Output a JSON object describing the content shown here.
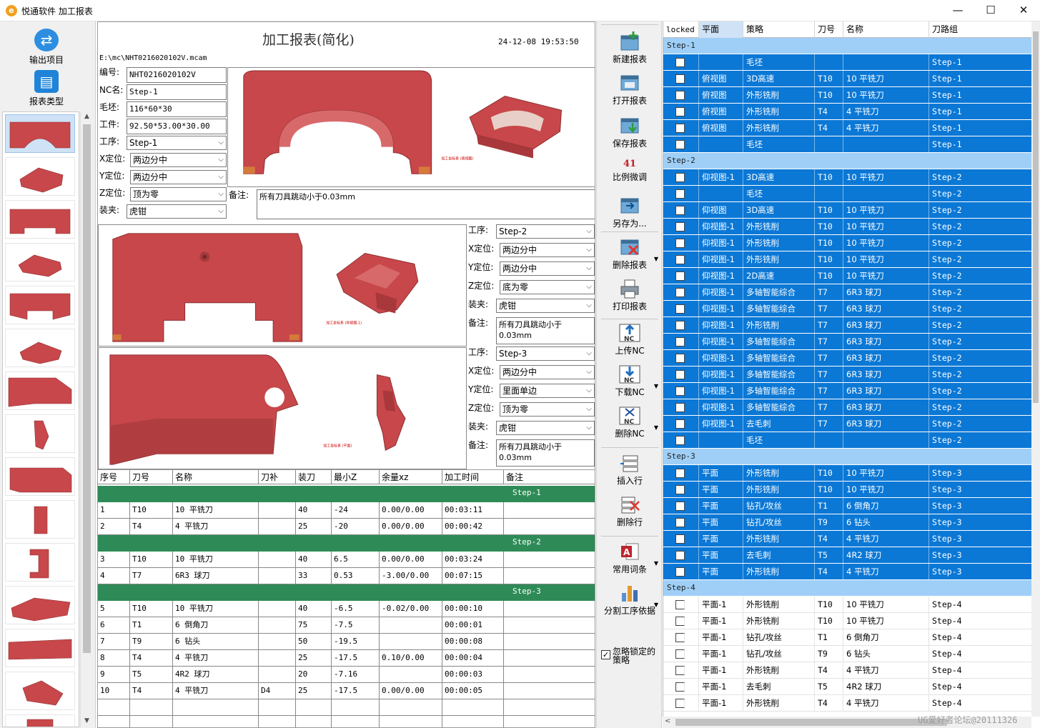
{
  "window": {
    "title": "悦通软件  加工报表",
    "minimize_label": "—",
    "maximize_label": "☐",
    "close_label": "✕"
  },
  "leftnav": {
    "export_label": "输出项目",
    "type_label": "报表类型"
  },
  "report": {
    "title": "加工报表(简化)",
    "datetime": "24-12-08 19:53:50",
    "path": "E:\\mc\\NHT0216020102V.mcam",
    "fields": {
      "number_label": "编号:",
      "number_value": "NHT0216020102V",
      "nc_label": "NC名:",
      "nc_value": "Step-1",
      "blank_label": "毛坯:",
      "blank_value": "116*60*30",
      "part_label": "工件:",
      "part_value": "92.50*53.00*30.00",
      "process_label": "工序:",
      "process_value": "Step-1",
      "x_label": "X定位:",
      "x_value": "两边分中",
      "y_label": "Y定位:",
      "y_value": "两边分中",
      "z_label": "Z定位:",
      "z_value": "顶为零",
      "clamp_label": "装夹:",
      "clamp_value": "虎钳",
      "note_label": "备注:",
      "note_value": "所有刀具跳动小于0.03mm"
    },
    "step2": {
      "process_label": "工序:",
      "process_value": "Step-2",
      "x_label": "X定位:",
      "x_value": "两边分中",
      "y_label": "Y定位:",
      "y_value": "两边分中",
      "z_label": "Z定位:",
      "z_value": "底为零",
      "clamp_label": "装夹:",
      "clamp_value": "虎钳",
      "note_label": "备注:",
      "note_value": "所有刀具跳动小于0.03mm"
    },
    "step3": {
      "process_label": "工序:",
      "process_value": "Step-3",
      "x_label": "X定位:",
      "x_value": "两边分中",
      "y_label": "Y定位:",
      "y_value": "里面单边",
      "z_label": "Z定位:",
      "z_value": "顶为零",
      "clamp_label": "装夹:",
      "clamp_value": "虎钳",
      "note_label": "备注:",
      "note_value": "所有刀具跳动小于0.03mm"
    },
    "ops_headers": [
      "序号",
      "刀号",
      "名称",
      "刀补",
      "装刀",
      "最小Z",
      "余量xz",
      "加工时间",
      "备注"
    ],
    "ops_groups": [
      {
        "label": "Step-1",
        "rows": [
          [
            "1",
            "T10",
            "10 平铣刀",
            "",
            "40",
            "-24",
            "0.00/0.00",
            "00:03:11",
            ""
          ],
          [
            "2",
            "T4",
            "4 平铣刀",
            "",
            "25",
            "-20",
            "0.00/0.00",
            "00:00:42",
            ""
          ]
        ]
      },
      {
        "label": "Step-2",
        "rows": [
          [
            "3",
            "T10",
            "10 平铣刀",
            "",
            "40",
            "6.5",
            "0.00/0.00",
            "00:03:24",
            ""
          ],
          [
            "4",
            "T7",
            "6R3 球刀",
            "",
            "33",
            "0.53",
            "-3.00/0.00",
            "00:07:15",
            ""
          ]
        ]
      },
      {
        "label": "Step-3",
        "rows": [
          [
            "5",
            "T10",
            "10 平铣刀",
            "",
            "40",
            "-6.5",
            "-0.02/0.00",
            "00:00:10",
            ""
          ],
          [
            "6",
            "T1",
            "6 倒角刀",
            "",
            "75",
            "-7.5",
            "",
            "00:00:01",
            ""
          ],
          [
            "7",
            "T9",
            "6 钻头",
            "",
            "50",
            "-19.5",
            "",
            "00:00:08",
            ""
          ],
          [
            "8",
            "T4",
            "4 平铣刀",
            "",
            "25",
            "-17.5",
            "0.10/0.00",
            "00:00:04",
            ""
          ],
          [
            "9",
            "T5",
            "4R2 球刀",
            "",
            "20",
            "-7.16",
            "",
            "00:00:03",
            ""
          ],
          [
            "10",
            "T4",
            "4 平铣刀",
            "D4",
            "25",
            "-17.5",
            "0.00/0.00",
            "00:00:05",
            ""
          ]
        ]
      }
    ]
  },
  "toolbar": {
    "new_report": "新建报表",
    "open_report": "打开报表",
    "save_report": "保存报表",
    "scale_value": "41",
    "scale_adjust": "比例微调",
    "save_as": "另存为...",
    "delete_report": "删除报表",
    "print_report": "打印报表",
    "upload_nc": "上传NC",
    "download_nc": "下载NC",
    "delete_nc": "删除NC",
    "insert_row": "插入行",
    "delete_row": "删除行",
    "common_terms": "常用词条",
    "split_process": "分割工序依据",
    "ignore_locked": "忽略锁定的策略",
    "nc_badge": "NC"
  },
  "grid": {
    "headers": [
      "locked",
      "平面",
      "策略",
      "刀号",
      "名称",
      "刀路组"
    ],
    "groups": [
      {
        "label": "Step-1",
        "selected": true,
        "rows": [
          [
            "",
            "毛坯",
            "",
            "",
            "Step-1"
          ],
          [
            "俯视图",
            "3D高速",
            "T10",
            "10 平铣刀",
            "Step-1"
          ],
          [
            "俯视图",
            "外形铣削",
            "T10",
            "10 平铣刀",
            "Step-1"
          ],
          [
            "俯视图",
            "外形铣削",
            "T4",
            "4 平铣刀",
            "Step-1"
          ],
          [
            "俯视图",
            "外形铣削",
            "T4",
            "4 平铣刀",
            "Step-1"
          ],
          [
            "",
            "毛坯",
            "",
            "",
            "Step-1"
          ]
        ]
      },
      {
        "label": "Step-2",
        "selected": true,
        "rows": [
          [
            "仰视图-1",
            "3D高速",
            "T10",
            "10 平铣刀",
            "Step-2"
          ],
          [
            "",
            "毛坯",
            "",
            "",
            "Step-2"
          ],
          [
            "仰视图",
            "3D高速",
            "T10",
            "10 平铣刀",
            "Step-2"
          ],
          [
            "仰视图-1",
            "外形铣削",
            "T10",
            "10 平铣刀",
            "Step-2"
          ],
          [
            "仰视图-1",
            "外形铣削",
            "T10",
            "10 平铣刀",
            "Step-2"
          ],
          [
            "仰视图-1",
            "外形铣削",
            "T10",
            "10 平铣刀",
            "Step-2"
          ],
          [
            "仰视图-1",
            "2D高速",
            "T10",
            "10 平铣刀",
            "Step-2"
          ],
          [
            "仰视图-1",
            "多轴智能综合",
            "T7",
            "6R3 球刀",
            "Step-2"
          ],
          [
            "仰视图-1",
            "多轴智能综合",
            "T7",
            "6R3 球刀",
            "Step-2"
          ],
          [
            "仰视图-1",
            "外形铣削",
            "T7",
            "6R3 球刀",
            "Step-2"
          ],
          [
            "仰视图-1",
            "多轴智能综合",
            "T7",
            "6R3 球刀",
            "Step-2"
          ],
          [
            "仰视图-1",
            "多轴智能综合",
            "T7",
            "6R3 球刀",
            "Step-2"
          ],
          [
            "仰视图-1",
            "多轴智能综合",
            "T7",
            "6R3 球刀",
            "Step-2"
          ],
          [
            "仰视图-1",
            "多轴智能综合",
            "T7",
            "6R3 球刀",
            "Step-2"
          ],
          [
            "仰视图-1",
            "多轴智能综合",
            "T7",
            "6R3 球刀",
            "Step-2"
          ],
          [
            "仰视图-1",
            "去毛刺",
            "T7",
            "6R3 球刀",
            "Step-2"
          ],
          [
            "",
            "毛坯",
            "",
            "",
            "Step-2"
          ]
        ]
      },
      {
        "label": "Step-3",
        "selected": true,
        "rows": [
          [
            "平面",
            "外形铣削",
            "T10",
            "10 平铣刀",
            "Step-3"
          ],
          [
            "平面",
            "外形铣削",
            "T10",
            "10 平铣刀",
            "Step-3"
          ],
          [
            "平面",
            "钻孔/攻丝",
            "T1",
            "6 倒角刀",
            "Step-3"
          ],
          [
            "平面",
            "钻孔/攻丝",
            "T9",
            "6 钻头",
            "Step-3"
          ],
          [
            "平面",
            "外形铣削",
            "T4",
            "4 平铣刀",
            "Step-3"
          ],
          [
            "平面",
            "去毛刺",
            "T5",
            "4R2 球刀",
            "Step-3"
          ],
          [
            "平面",
            "外形铣削",
            "T4",
            "4 平铣刀",
            "Step-3"
          ]
        ]
      },
      {
        "label": "Step-4",
        "selected": false,
        "rows": [
          [
            "平面-1",
            "外形铣削",
            "T10",
            "10 平铣刀",
            "Step-4"
          ],
          [
            "平面-1",
            "外形铣削",
            "T10",
            "10 平铣刀",
            "Step-4"
          ],
          [
            "平面-1",
            "钻孔/攻丝",
            "T1",
            "6 倒角刀",
            "Step-4"
          ],
          [
            "平面-1",
            "钻孔/攻丝",
            "T9",
            "6 钻头",
            "Step-4"
          ],
          [
            "平面-1",
            "外形铣削",
            "T4",
            "4 平铣刀",
            "Step-4"
          ],
          [
            "平面-1",
            "去毛刺",
            "T5",
            "4R2 球刀",
            "Step-4"
          ],
          [
            "平面-1",
            "外形铣削",
            "T4",
            "4 平铣刀",
            "Step-4"
          ]
        ]
      }
    ]
  },
  "watermark": "UG爱好者论坛@20111326",
  "colors": {
    "selection_blue": "#0b78d6",
    "group_blue": "#9fcff7",
    "step_green": "#2e8b57",
    "part_red": "#c8474a"
  }
}
